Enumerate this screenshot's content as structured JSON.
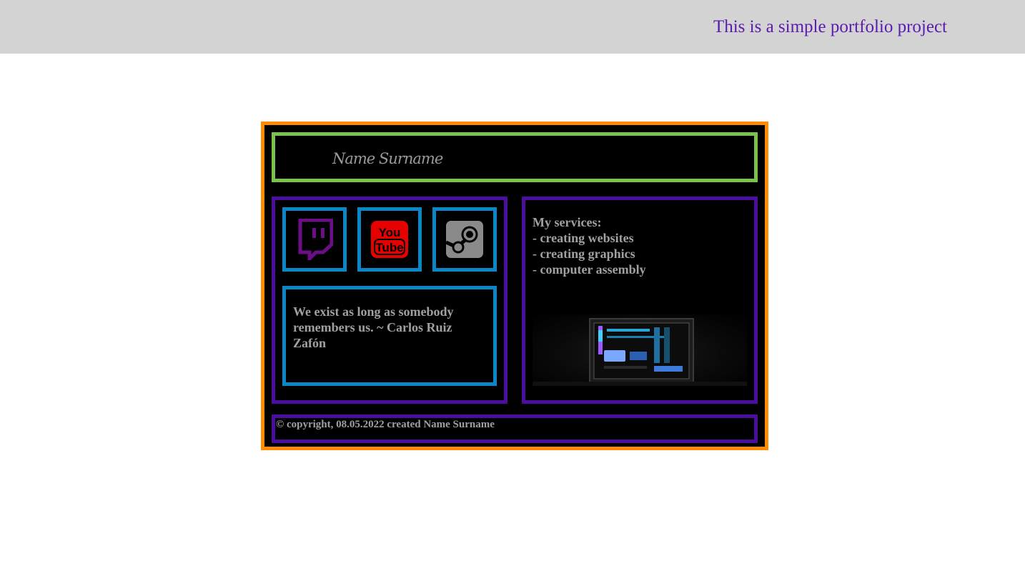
{
  "topbar": {
    "tagline": "This is a simple portfolio project"
  },
  "header": {
    "name": "Name Surname"
  },
  "social": [
    {
      "icon": "twitch-icon",
      "color": "#6a0f87"
    },
    {
      "icon": "youtube-icon",
      "color": "#e60000"
    },
    {
      "icon": "steam-icon",
      "color": "#8a8a8a"
    }
  ],
  "quote": {
    "text": "We exist as long as somebody remembers us. ~ Carlos Ruiz Zafón"
  },
  "services": {
    "heading": "My services:",
    "items": [
      "- creating websites",
      "- creating graphics",
      "- computer assembly"
    ]
  },
  "footer": {
    "copyright": "© copyright, 08.05.2022 created Name Surname"
  },
  "colors": {
    "card_border": "#ff8c00",
    "header_border": "#7cc24a",
    "panel_border": "#4b0fa0",
    "icon_border": "#0b86c6",
    "tagline": "#5b1ab0",
    "topbar_bg": "#d3d3d3"
  }
}
